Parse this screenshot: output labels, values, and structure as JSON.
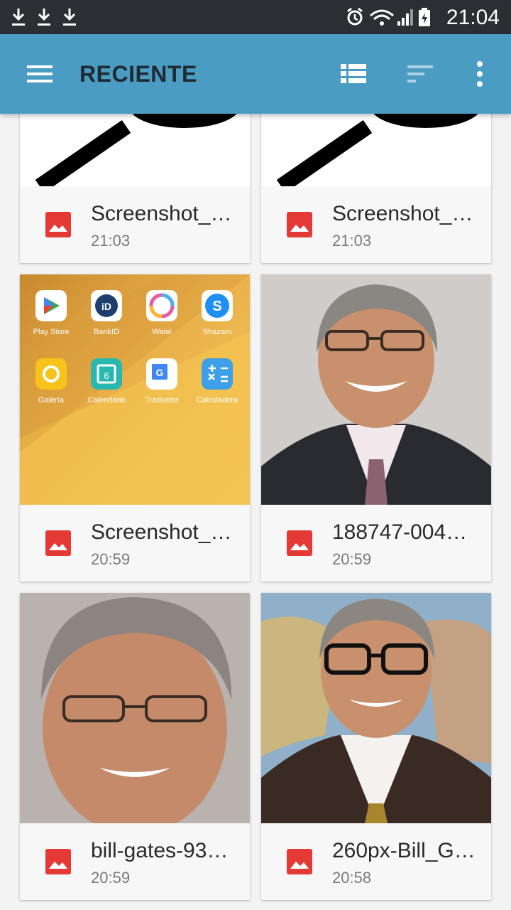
{
  "status_bar": {
    "time": "21:04",
    "left_icons": [
      "download-icon",
      "download-icon",
      "download-icon"
    ],
    "right_icons": [
      "alarm-icon",
      "wifi-icon",
      "signal-icon",
      "battery-charging-icon"
    ]
  },
  "app_bar": {
    "title": "RECIENTE",
    "color": "#4a9cc2",
    "icons": [
      "menu-icon",
      "list-view-icon",
      "sort-icon",
      "more-vert-icon"
    ]
  },
  "files": [
    {
      "name": "Screenshot_…",
      "time": "21:03",
      "thumb": "magnifier-image"
    },
    {
      "name": "Screenshot_…",
      "time": "21:03",
      "thumb": "magnifier-image"
    },
    {
      "name": "Screenshot_…",
      "time": "20:59",
      "thumb": "homescreen-image",
      "apps": [
        "Play Store",
        "BankID",
        "Waist",
        "Shazam",
        "Galería",
        "Calendario",
        "Traductor",
        "Calculadora"
      ]
    },
    {
      "name": "188747-004…",
      "time": "20:59",
      "thumb": "portrait-photo"
    },
    {
      "name": "bill-gates-93…",
      "time": "20:59",
      "thumb": "portrait-photo"
    },
    {
      "name": "260px-Bill_G…",
      "time": "20:58",
      "thumb": "portrait-photo"
    }
  ],
  "file_icon_color": "#e53935"
}
